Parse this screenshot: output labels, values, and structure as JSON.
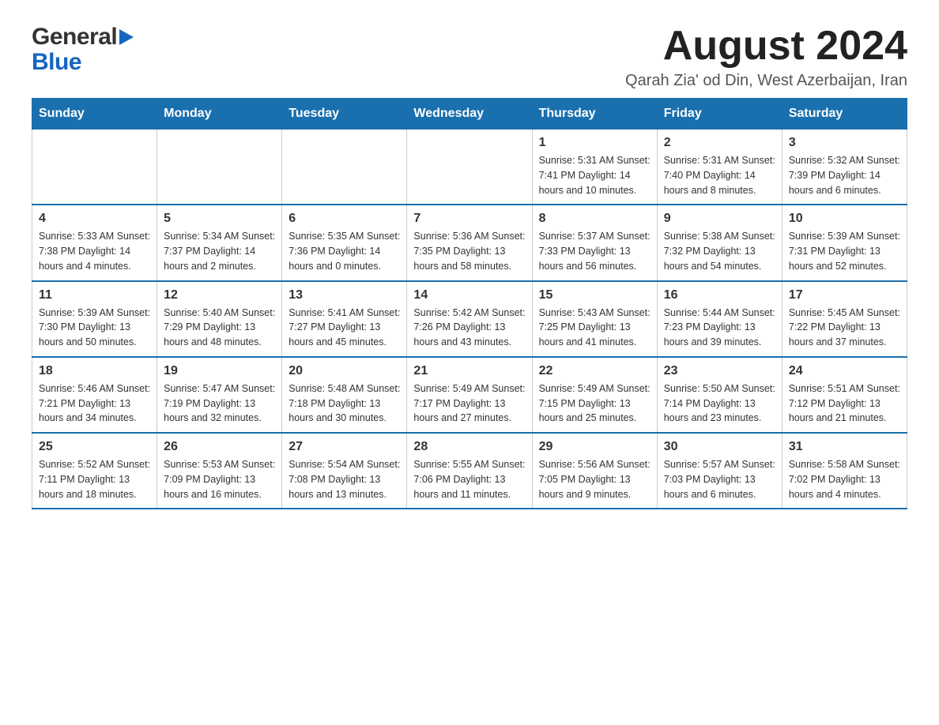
{
  "logo": {
    "line1": "General",
    "line2": "Blue"
  },
  "title": "August 2024",
  "subtitle": "Qarah Zia' od Din, West Azerbaijan, Iran",
  "days_of_week": [
    "Sunday",
    "Monday",
    "Tuesday",
    "Wednesday",
    "Thursday",
    "Friday",
    "Saturday"
  ],
  "weeks": [
    [
      {
        "day": "",
        "info": ""
      },
      {
        "day": "",
        "info": ""
      },
      {
        "day": "",
        "info": ""
      },
      {
        "day": "",
        "info": ""
      },
      {
        "day": "1",
        "info": "Sunrise: 5:31 AM\nSunset: 7:41 PM\nDaylight: 14 hours\nand 10 minutes."
      },
      {
        "day": "2",
        "info": "Sunrise: 5:31 AM\nSunset: 7:40 PM\nDaylight: 14 hours\nand 8 minutes."
      },
      {
        "day": "3",
        "info": "Sunrise: 5:32 AM\nSunset: 7:39 PM\nDaylight: 14 hours\nand 6 minutes."
      }
    ],
    [
      {
        "day": "4",
        "info": "Sunrise: 5:33 AM\nSunset: 7:38 PM\nDaylight: 14 hours\nand 4 minutes."
      },
      {
        "day": "5",
        "info": "Sunrise: 5:34 AM\nSunset: 7:37 PM\nDaylight: 14 hours\nand 2 minutes."
      },
      {
        "day": "6",
        "info": "Sunrise: 5:35 AM\nSunset: 7:36 PM\nDaylight: 14 hours\nand 0 minutes."
      },
      {
        "day": "7",
        "info": "Sunrise: 5:36 AM\nSunset: 7:35 PM\nDaylight: 13 hours\nand 58 minutes."
      },
      {
        "day": "8",
        "info": "Sunrise: 5:37 AM\nSunset: 7:33 PM\nDaylight: 13 hours\nand 56 minutes."
      },
      {
        "day": "9",
        "info": "Sunrise: 5:38 AM\nSunset: 7:32 PM\nDaylight: 13 hours\nand 54 minutes."
      },
      {
        "day": "10",
        "info": "Sunrise: 5:39 AM\nSunset: 7:31 PM\nDaylight: 13 hours\nand 52 minutes."
      }
    ],
    [
      {
        "day": "11",
        "info": "Sunrise: 5:39 AM\nSunset: 7:30 PM\nDaylight: 13 hours\nand 50 minutes."
      },
      {
        "day": "12",
        "info": "Sunrise: 5:40 AM\nSunset: 7:29 PM\nDaylight: 13 hours\nand 48 minutes."
      },
      {
        "day": "13",
        "info": "Sunrise: 5:41 AM\nSunset: 7:27 PM\nDaylight: 13 hours\nand 45 minutes."
      },
      {
        "day": "14",
        "info": "Sunrise: 5:42 AM\nSunset: 7:26 PM\nDaylight: 13 hours\nand 43 minutes."
      },
      {
        "day": "15",
        "info": "Sunrise: 5:43 AM\nSunset: 7:25 PM\nDaylight: 13 hours\nand 41 minutes."
      },
      {
        "day": "16",
        "info": "Sunrise: 5:44 AM\nSunset: 7:23 PM\nDaylight: 13 hours\nand 39 minutes."
      },
      {
        "day": "17",
        "info": "Sunrise: 5:45 AM\nSunset: 7:22 PM\nDaylight: 13 hours\nand 37 minutes."
      }
    ],
    [
      {
        "day": "18",
        "info": "Sunrise: 5:46 AM\nSunset: 7:21 PM\nDaylight: 13 hours\nand 34 minutes."
      },
      {
        "day": "19",
        "info": "Sunrise: 5:47 AM\nSunset: 7:19 PM\nDaylight: 13 hours\nand 32 minutes."
      },
      {
        "day": "20",
        "info": "Sunrise: 5:48 AM\nSunset: 7:18 PM\nDaylight: 13 hours\nand 30 minutes."
      },
      {
        "day": "21",
        "info": "Sunrise: 5:49 AM\nSunset: 7:17 PM\nDaylight: 13 hours\nand 27 minutes."
      },
      {
        "day": "22",
        "info": "Sunrise: 5:49 AM\nSunset: 7:15 PM\nDaylight: 13 hours\nand 25 minutes."
      },
      {
        "day": "23",
        "info": "Sunrise: 5:50 AM\nSunset: 7:14 PM\nDaylight: 13 hours\nand 23 minutes."
      },
      {
        "day": "24",
        "info": "Sunrise: 5:51 AM\nSunset: 7:12 PM\nDaylight: 13 hours\nand 21 minutes."
      }
    ],
    [
      {
        "day": "25",
        "info": "Sunrise: 5:52 AM\nSunset: 7:11 PM\nDaylight: 13 hours\nand 18 minutes."
      },
      {
        "day": "26",
        "info": "Sunrise: 5:53 AM\nSunset: 7:09 PM\nDaylight: 13 hours\nand 16 minutes."
      },
      {
        "day": "27",
        "info": "Sunrise: 5:54 AM\nSunset: 7:08 PM\nDaylight: 13 hours\nand 13 minutes."
      },
      {
        "day": "28",
        "info": "Sunrise: 5:55 AM\nSunset: 7:06 PM\nDaylight: 13 hours\nand 11 minutes."
      },
      {
        "day": "29",
        "info": "Sunrise: 5:56 AM\nSunset: 7:05 PM\nDaylight: 13 hours\nand 9 minutes."
      },
      {
        "day": "30",
        "info": "Sunrise: 5:57 AM\nSunset: 7:03 PM\nDaylight: 13 hours\nand 6 minutes."
      },
      {
        "day": "31",
        "info": "Sunrise: 5:58 AM\nSunset: 7:02 PM\nDaylight: 13 hours\nand 4 minutes."
      }
    ]
  ]
}
